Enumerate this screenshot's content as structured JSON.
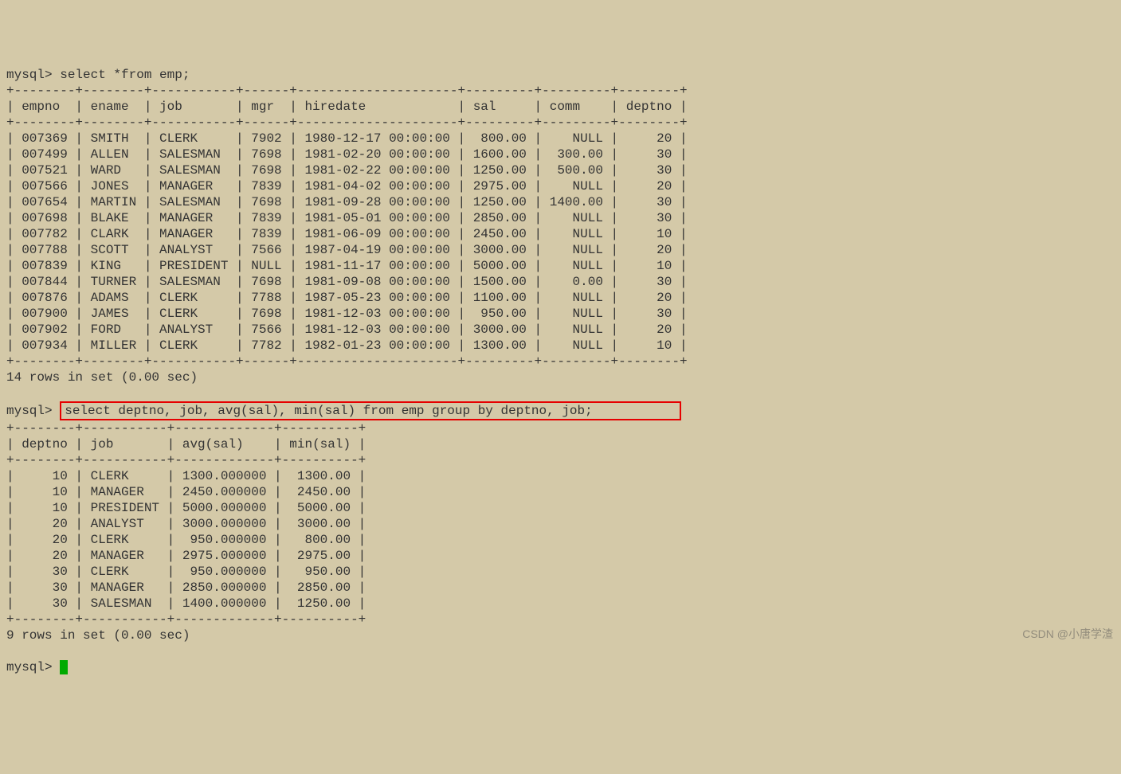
{
  "prompt_label": "mysql>",
  "query1": "select *from emp;",
  "table1": {
    "border_top": "+--------+--------+-----------+------+---------------------+---------+---------+--------+",
    "border_mid": "+--------+--------+-----------+------+---------------------+---------+---------+--------+",
    "border_bot": "+--------+--------+-----------+------+---------------------+---------+---------+--------+",
    "header": "| empno  | ename  | job       | mgr  | hiredate            | sal     | comm    | deptno |",
    "rows": [
      "| 007369 | SMITH  | CLERK     | 7902 | 1980-12-17 00:00:00 |  800.00 |    NULL |     20 |",
      "| 007499 | ALLEN  | SALESMAN  | 7698 | 1981-02-20 00:00:00 | 1600.00 |  300.00 |     30 |",
      "| 007521 | WARD   | SALESMAN  | 7698 | 1981-02-22 00:00:00 | 1250.00 |  500.00 |     30 |",
      "| 007566 | JONES  | MANAGER   | 7839 | 1981-04-02 00:00:00 | 2975.00 |    NULL |     20 |",
      "| 007654 | MARTIN | SALESMAN  | 7698 | 1981-09-28 00:00:00 | 1250.00 | 1400.00 |     30 |",
      "| 007698 | BLAKE  | MANAGER   | 7839 | 1981-05-01 00:00:00 | 2850.00 |    NULL |     30 |",
      "| 007782 | CLARK  | MANAGER   | 7839 | 1981-06-09 00:00:00 | 2450.00 |    NULL |     10 |",
      "| 007788 | SCOTT  | ANALYST   | 7566 | 1987-04-19 00:00:00 | 3000.00 |    NULL |     20 |",
      "| 007839 | KING   | PRESIDENT | NULL | 1981-11-17 00:00:00 | 5000.00 |    NULL |     10 |",
      "| 007844 | TURNER | SALESMAN  | 7698 | 1981-09-08 00:00:00 | 1500.00 |    0.00 |     30 |",
      "| 007876 | ADAMS  | CLERK     | 7788 | 1987-05-23 00:00:00 | 1100.00 |    NULL |     20 |",
      "| 007900 | JAMES  | CLERK     | 7698 | 1981-12-03 00:00:00 |  950.00 |    NULL |     30 |",
      "| 007902 | FORD   | ANALYST   | 7566 | 1981-12-03 00:00:00 | 3000.00 |    NULL |     20 |",
      "| 007934 | MILLER | CLERK     | 7782 | 1982-01-23 00:00:00 | 1300.00 |    NULL |     10 |"
    ],
    "summary": "14 rows in set (0.00 sec)"
  },
  "query2": "select deptno, job, avg(sal), min(sal) from emp group by deptno, job;",
  "table2": {
    "border_top": "+--------+-----------+-------------+----------+",
    "border_mid": "+--------+-----------+-------------+----------+",
    "border_bot": "+--------+-----------+-------------+----------+",
    "header": "| deptno | job       | avg(sal)    | min(sal) |",
    "rows": [
      "|     10 | CLERK     | 1300.000000 |  1300.00 |",
      "|     10 | MANAGER   | 2450.000000 |  2450.00 |",
      "|     10 | PRESIDENT | 5000.000000 |  5000.00 |",
      "|     20 | ANALYST   | 3000.000000 |  3000.00 |",
      "|     20 | CLERK     |  950.000000 |   800.00 |",
      "|     20 | MANAGER   | 2975.000000 |  2975.00 |",
      "|     30 | CLERK     |  950.000000 |   950.00 |",
      "|     30 | MANAGER   | 2850.000000 |  2850.00 |",
      "|     30 | SALESMAN  | 1400.000000 |  1250.00 |"
    ],
    "summary": "9 rows in set (0.00 sec)"
  },
  "watermark": "CSDN @小唐学渣"
}
